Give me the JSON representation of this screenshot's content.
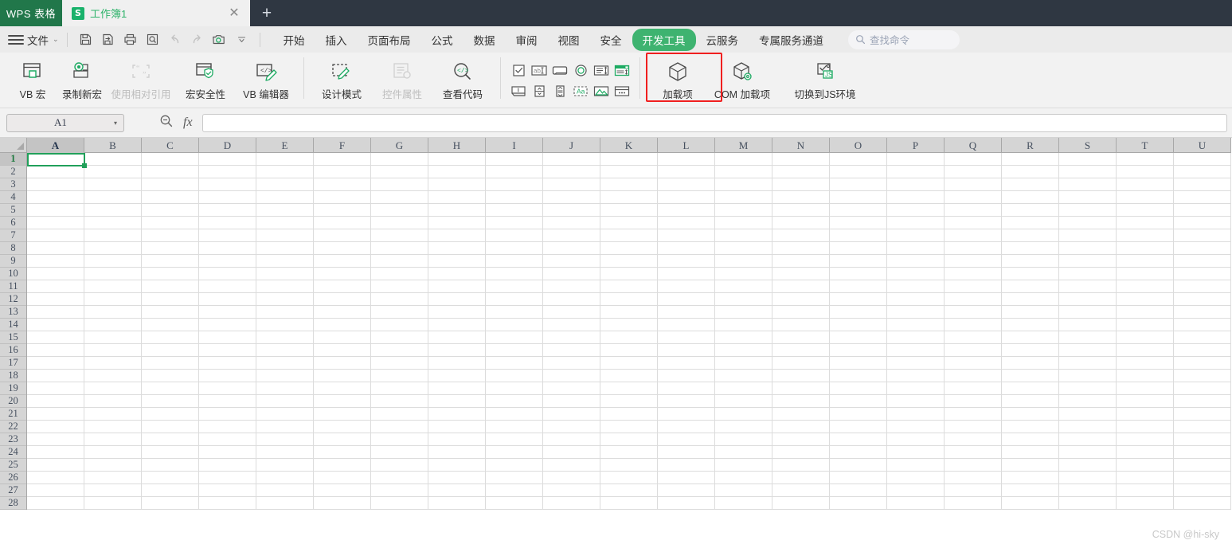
{
  "titlebar": {
    "app_badge": "WPS 表格",
    "doc_tab": {
      "icon": "spreadsheet-s-icon",
      "label": "工作簿1",
      "close": "✕"
    },
    "new_tab": "+"
  },
  "menurow": {
    "file_label": "文件",
    "file_caret": "⌄",
    "quick_access": [
      {
        "name": "save-icon",
        "disabled": false
      },
      {
        "name": "save-as-icon",
        "disabled": false
      },
      {
        "name": "print-icon",
        "disabled": false
      },
      {
        "name": "print-preview-icon",
        "disabled": false
      },
      {
        "name": "undo-icon",
        "disabled": true
      },
      {
        "name": "redo-icon",
        "disabled": true
      },
      {
        "name": "screenshot-camera-icon",
        "disabled": false
      },
      {
        "name": "qat-more-chevron-icon",
        "disabled": false
      }
    ],
    "tabs": [
      {
        "label": "开始",
        "active": false
      },
      {
        "label": "插入",
        "active": false
      },
      {
        "label": "页面布局",
        "active": false
      },
      {
        "label": "公式",
        "active": false
      },
      {
        "label": "数据",
        "active": false
      },
      {
        "label": "审阅",
        "active": false
      },
      {
        "label": "视图",
        "active": false
      },
      {
        "label": "安全",
        "active": false
      },
      {
        "label": "开发工具",
        "active": true
      },
      {
        "label": "云服务",
        "active": false
      },
      {
        "label": "专属服务通道",
        "active": false
      }
    ],
    "search": {
      "icon": "search-icon",
      "placeholder": "查找命令"
    }
  },
  "ribbon": {
    "group_macro": [
      {
        "label": "VB 宏",
        "icon": "vb-macro-icon",
        "disabled": false
      },
      {
        "label": "录制新宏",
        "icon": "record-macro-icon",
        "disabled": false
      },
      {
        "label": "使用相对引用",
        "icon": "relative-reference-icon",
        "disabled": true
      },
      {
        "label": "宏安全性",
        "icon": "macro-security-icon",
        "disabled": false
      },
      {
        "label": "VB 编辑器",
        "icon": "vb-editor-icon",
        "disabled": false
      }
    ],
    "group_controls": [
      {
        "label": "设计模式",
        "icon": "design-mode-icon",
        "disabled": false
      },
      {
        "label": "控件属性",
        "icon": "control-properties-icon",
        "disabled": true
      },
      {
        "label": "查看代码",
        "icon": "view-code-icon",
        "disabled": false
      }
    ],
    "group_form_controls": [
      {
        "name": "checkbox-control-icon"
      },
      {
        "name": "textbox-control-icon"
      },
      {
        "name": "button-control-icon"
      },
      {
        "name": "option-button-control-icon"
      },
      {
        "name": "listbox-control-icon"
      },
      {
        "name": "combobox-control-icon"
      },
      {
        "name": "toggle-button-control-icon"
      },
      {
        "name": "spin-button-control-icon"
      },
      {
        "name": "scrollbar-control-icon"
      },
      {
        "name": "label-control-icon"
      },
      {
        "name": "image-control-icon"
      },
      {
        "name": "more-controls-icon"
      }
    ],
    "group_addins": [
      {
        "label": "加载项",
        "icon": "addin-cube-icon",
        "disabled": false
      },
      {
        "label": "COM 加载项",
        "icon": "com-addin-cube-icon",
        "disabled": false
      },
      {
        "label": "切换到JS环境",
        "icon": "switch-js-env-icon",
        "disabled": false,
        "highlighted": true
      }
    ]
  },
  "formulabar": {
    "namebox_value": "A1",
    "namebox_caret": "▾",
    "zoom_icon": "zoom-search-icon",
    "fx_label": "fx",
    "formula_value": ""
  },
  "sheet": {
    "columns": [
      "A",
      "B",
      "C",
      "D",
      "E",
      "F",
      "G",
      "H",
      "I",
      "J",
      "K",
      "L",
      "M",
      "N",
      "O",
      "P",
      "Q",
      "R",
      "S",
      "T",
      "U"
    ],
    "selected_column": "A",
    "rows": [
      1,
      2,
      3,
      4,
      5,
      6,
      7,
      8,
      9,
      10,
      11,
      12,
      13,
      14,
      15,
      16,
      17,
      18,
      19,
      20,
      21,
      22,
      23,
      24,
      25,
      26,
      27,
      28
    ],
    "selected_row": 1,
    "active_cell": "A1",
    "active_cell_value": "",
    "watermark": "CSDN @hi-sky"
  },
  "colors": {
    "brand_green": "#21774a",
    "accent_green": "#3eb370",
    "selection_green": "#21a05a",
    "highlight_red": "#f01f1f",
    "titlebar_bg": "#2f3742",
    "ribbon_bg": "#f2f2f2"
  }
}
